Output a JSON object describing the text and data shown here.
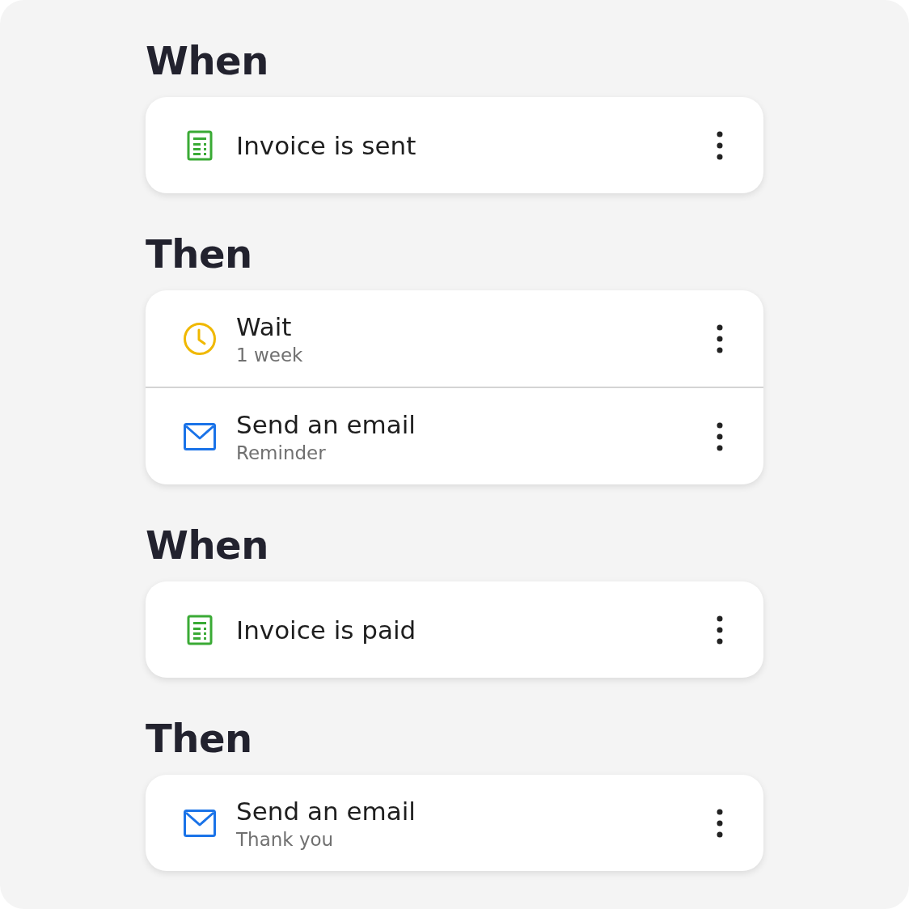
{
  "sections": [
    {
      "heading": "When",
      "steps": [
        {
          "kind": "invoice",
          "title": "Invoice is sent"
        }
      ]
    },
    {
      "heading": "Then",
      "steps": [
        {
          "kind": "wait",
          "title": "Wait",
          "subtitle": "1 week"
        },
        {
          "kind": "email",
          "title": "Send an email",
          "subtitle": "Reminder"
        }
      ]
    },
    {
      "heading": "When",
      "steps": [
        {
          "kind": "invoice",
          "title": "Invoice is paid"
        }
      ]
    },
    {
      "heading": "Then",
      "steps": [
        {
          "kind": "email",
          "title": "Send an email",
          "subtitle": "Thank you"
        }
      ]
    }
  ]
}
